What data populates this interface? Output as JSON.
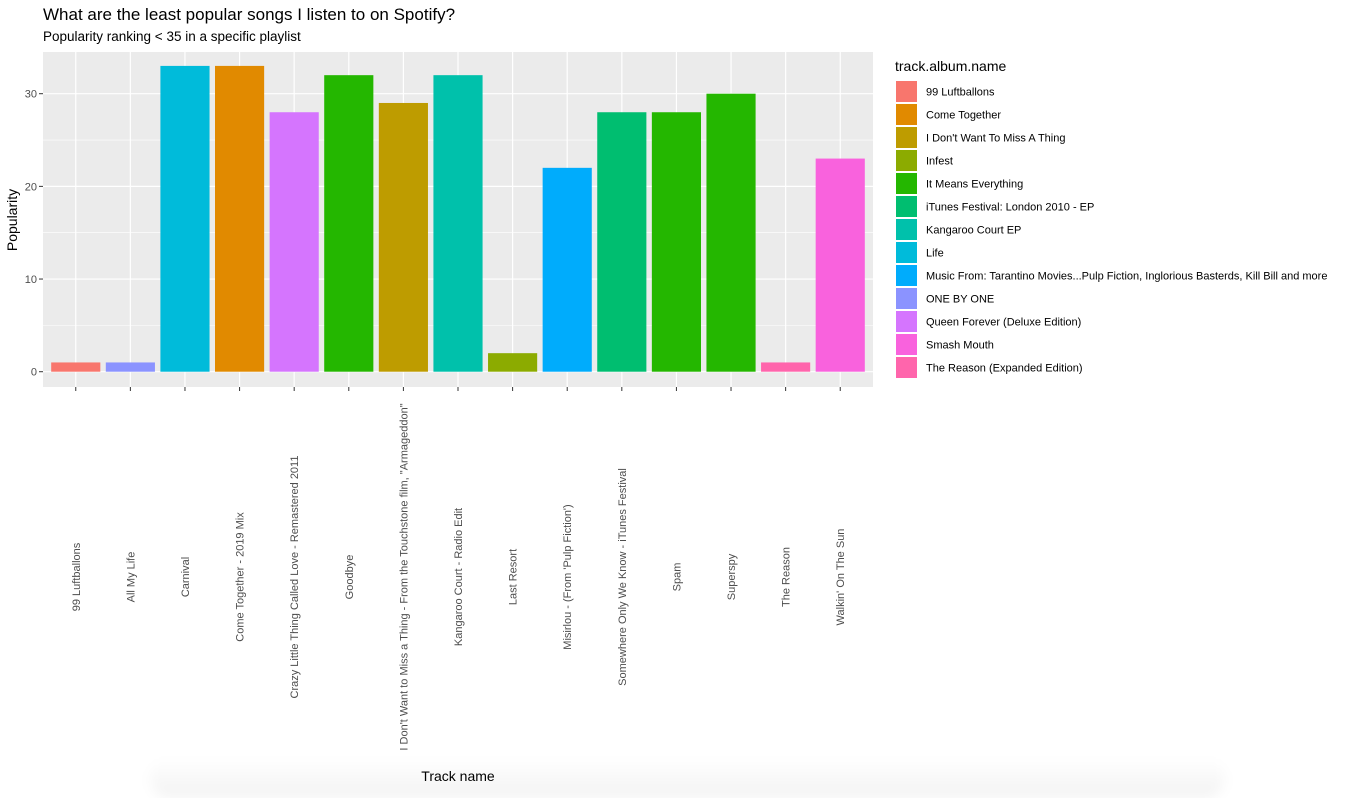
{
  "chart_data": {
    "type": "bar",
    "title": "What are the least popular songs I listen to on Spotify?",
    "subtitle": "Popularity ranking < 35 in a specific playlist",
    "xlabel": "Track name",
    "ylabel": "Popularity",
    "ylim": [
      -1.65,
      34.5
    ],
    "yticks": [
      0,
      10,
      20,
      30
    ],
    "grid": true,
    "legend_title": "track.album.name",
    "legend_position": "right",
    "categories": [
      "99 Luftballons",
      "All My Life",
      "Carnival",
      "Come Together - 2019 Mix",
      "Crazy Little Thing Called Love - Remastered 2011",
      "Goodbye",
      "I Don't Want to Miss a Thing - From the Touchstone film, \"Armageddon\"",
      "Kangaroo Court - Radio Edit",
      "Last Resort",
      "Misirlou - (From 'Pulp Fiction')",
      "Somewhere Only We Know - iTunes Festival",
      "Spam",
      "Superspy",
      "The Reason",
      "Walkin' On The Sun"
    ],
    "values": [
      1,
      1,
      33,
      33,
      28,
      32,
      29,
      32,
      2,
      22,
      28,
      28,
      30,
      1,
      23
    ],
    "fill_album": [
      "99 Luftballons",
      "ONE BY ONE",
      "Life",
      "Come Together",
      "Queen Forever (Deluxe Edition)",
      "It Means Everything",
      "I Don't Want To Miss A Thing",
      "Kangaroo Court EP",
      "Infest",
      "Music From: Tarantino Movies...Pulp Fiction, Inglorious Basterds, Kill Bill and more",
      "iTunes Festival: London 2010 - EP",
      "It Means Everything",
      "It Means Everything",
      "The Reason (Expanded Edition)",
      "Smash Mouth"
    ],
    "legend": [
      {
        "label": "99 Luftballons",
        "color": "#F8766D"
      },
      {
        "label": "Come Together",
        "color": "#E18A00"
      },
      {
        "label": "I Don't Want To Miss A Thing",
        "color": "#BE9C00"
      },
      {
        "label": "Infest",
        "color": "#8CAB00"
      },
      {
        "label": "It Means Everything",
        "color": "#24B700"
      },
      {
        "label": "iTunes Festival: London 2010 - EP",
        "color": "#00BE70"
      },
      {
        "label": "Kangaroo Court EP",
        "color": "#00C1AB"
      },
      {
        "label": "Life",
        "color": "#00BBDA"
      },
      {
        "label": "Music From: Tarantino Movies...Pulp Fiction, Inglorious Basterds, Kill Bill and more",
        "color": "#00ACFC"
      },
      {
        "label": "ONE BY ONE",
        "color": "#8B93FF"
      },
      {
        "label": "Queen Forever (Deluxe Edition)",
        "color": "#D575FE"
      },
      {
        "label": "Smash Mouth",
        "color": "#F962DD"
      },
      {
        "label": "The Reason (Expanded Edition)",
        "color": "#FF65AC"
      }
    ]
  }
}
